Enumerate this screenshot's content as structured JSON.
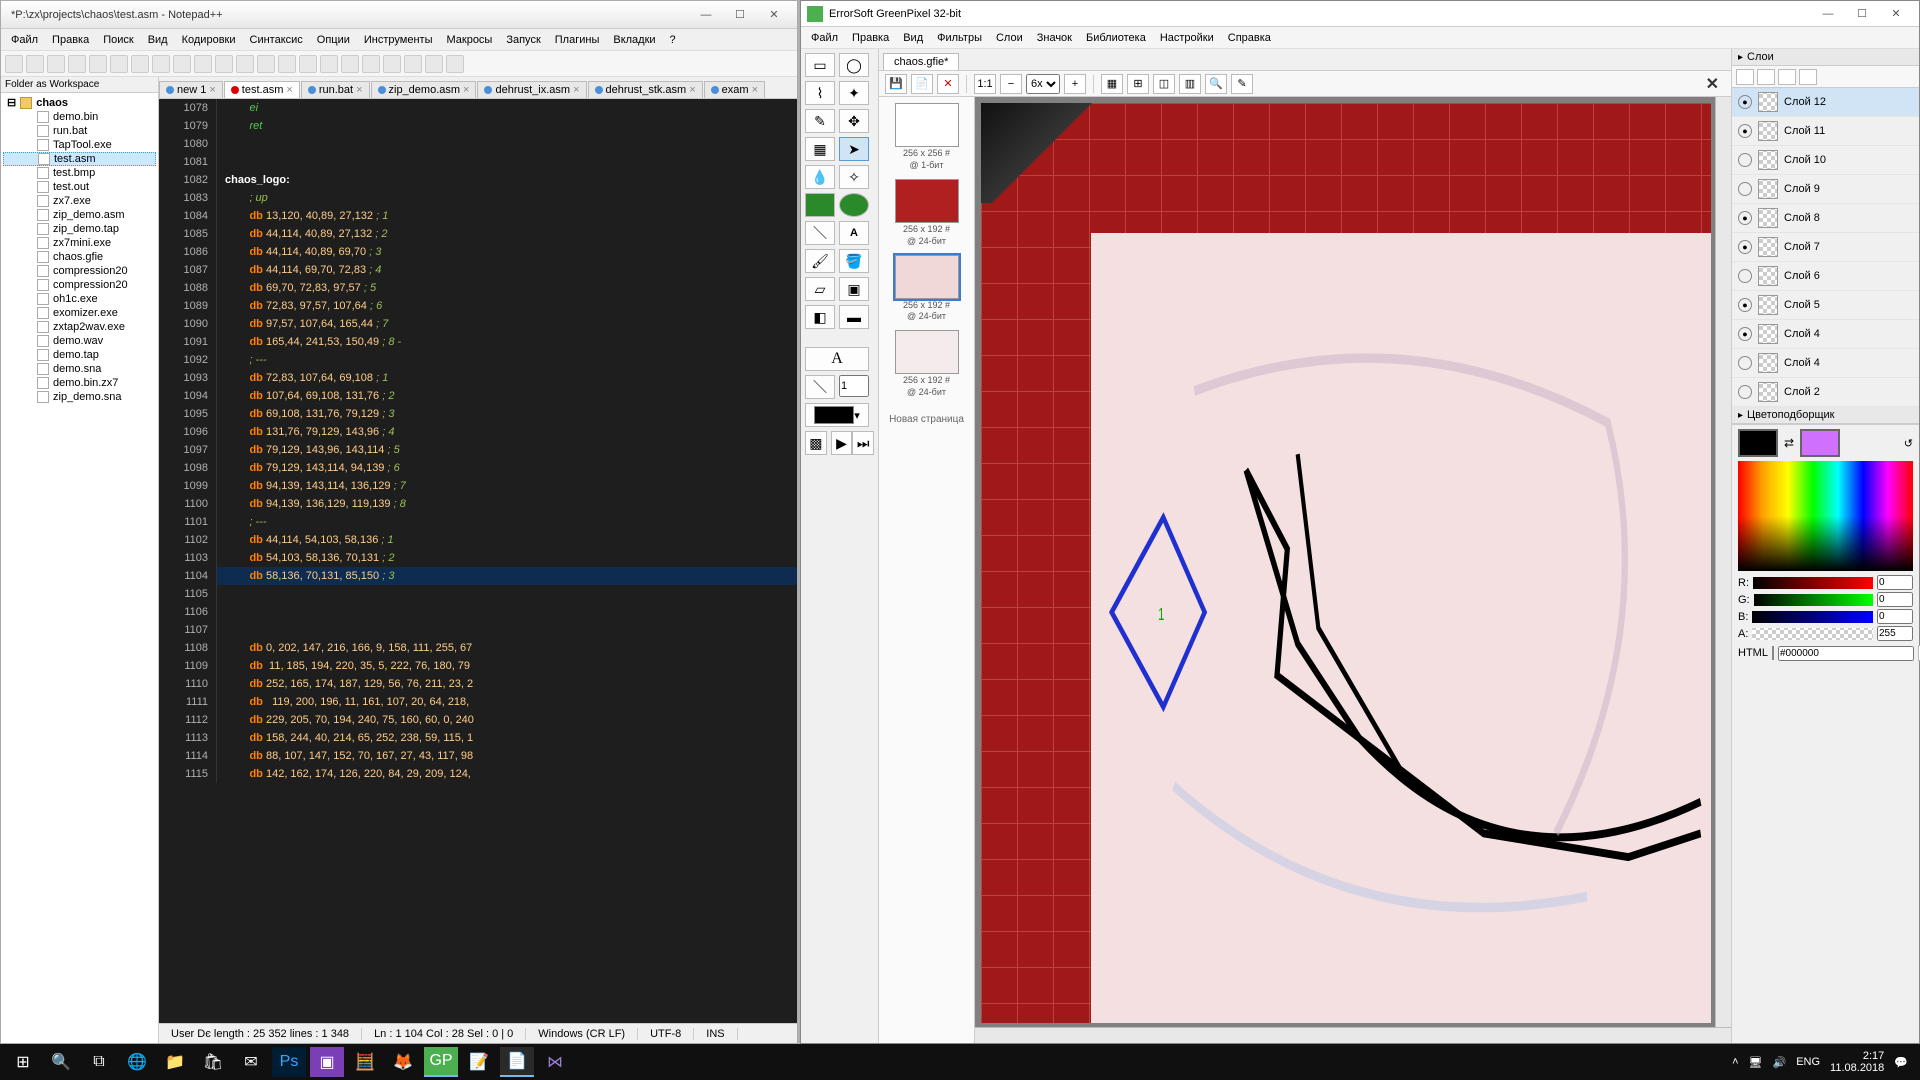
{
  "notepad": {
    "title": "*P:\\zx\\projects\\chaos\\test.asm - Notepad++",
    "menu": [
      "Файл",
      "Правка",
      "Поиск",
      "Вид",
      "Кодировки",
      "Синтаксис",
      "Опции",
      "Инструменты",
      "Макросы",
      "Запуск",
      "Плагины",
      "Вкладки",
      "?"
    ],
    "folder_title": "Folder as Workspace",
    "tree_root": "chaos",
    "tree": [
      "demo.bin",
      "run.bat",
      "TapTool.exe",
      "test.asm",
      "test.bmp",
      "test.out",
      "zx7.exe",
      "zip_demo.asm",
      "zip_demo.tap",
      "zx7mini.exe",
      "chaos.gfie",
      "compression20",
      "compression20",
      "oh1c.exe",
      "exomizer.exe",
      "zxtap2wav.exe",
      "demo.wav",
      "demo.tap",
      "demo.sna",
      "demo.bin.zx7",
      "zip_demo.sna"
    ],
    "tree_sel": "test.asm",
    "tabs": [
      {
        "label": "new 1",
        "mod": false
      },
      {
        "label": "test.asm",
        "mod": true,
        "active": true
      },
      {
        "label": "run.bat",
        "mod": false
      },
      {
        "label": "zip_demo.asm",
        "mod": false
      },
      {
        "label": "dehrust_ix.asm",
        "mod": false
      },
      {
        "label": "dehrust_stk.asm",
        "mod": false
      },
      {
        "label": "exam",
        "mod": false
      }
    ],
    "code": [
      {
        "n": "1078",
        "t": "        ei",
        "k": "green"
      },
      {
        "n": "1079",
        "t": "        ret",
        "k": "green"
      },
      {
        "n": "1080",
        "t": ""
      },
      {
        "n": "1081",
        "t": ""
      },
      {
        "n": "1082",
        "t": "chaos_logo:",
        "k": "label"
      },
      {
        "n": "1083",
        "t": "        ; up",
        "k": "cmt"
      },
      {
        "n": "1084",
        "db": "db",
        "args": "13,120, 40,89, 27,132",
        "c": "; 1"
      },
      {
        "n": "1085",
        "db": "db",
        "args": "44,114, 40,89, 27,132",
        "c": "; 2"
      },
      {
        "n": "1086",
        "db": "db",
        "args": "44,114, 40,89, 69,70",
        "c": "; 3"
      },
      {
        "n": "1087",
        "db": "db",
        "args": "44,114, 69,70, 72,83",
        "c": "; 4"
      },
      {
        "n": "1088",
        "db": "db",
        "args": "69,70, 72,83, 97,57",
        "c": "; 5"
      },
      {
        "n": "1089",
        "db": "db",
        "args": "72,83, 97,57, 107,64",
        "c": "; 6"
      },
      {
        "n": "1090",
        "db": "db",
        "args": "97,57, 107,64, 165,44",
        "c": "; 7"
      },
      {
        "n": "1091",
        "db": "db",
        "args": "165,44, 241,53, 150,49",
        "c": "; 8 -"
      },
      {
        "n": "1092",
        "t": "        ; ---",
        "k": "cmt"
      },
      {
        "n": "1093",
        "db": "db",
        "args": "72,83, 107,64, 69,108",
        "c": "; 1"
      },
      {
        "n": "1094",
        "db": "db",
        "args": "107,64, 69,108, 131,76",
        "c": "; 2"
      },
      {
        "n": "1095",
        "db": "db",
        "args": "69,108, 131,76, 79,129",
        "c": "; 3"
      },
      {
        "n": "1096",
        "db": "db",
        "args": "131,76, 79,129, 143,96",
        "c": "; 4"
      },
      {
        "n": "1097",
        "db": "db",
        "args": "79,129, 143,96, 143,114",
        "c": "; 5"
      },
      {
        "n": "1098",
        "db": "db",
        "args": "79,129, 143,114, 94,139",
        "c": "; 6"
      },
      {
        "n": "1099",
        "db": "db",
        "args": "94,139, 143,114, 136,129",
        "c": "; 7"
      },
      {
        "n": "1100",
        "db": "db",
        "args": "94,139, 136,129, 119,139",
        "c": "; 8"
      },
      {
        "n": "1101",
        "t": "        ; ---",
        "k": "cmt"
      },
      {
        "n": "1102",
        "db": "db",
        "args": "44,114, 54,103, 58,136",
        "c": "; 1"
      },
      {
        "n": "1103",
        "db": "db",
        "args": "54,103, 58,136, 70,131",
        "c": "; 2"
      },
      {
        "n": "1104",
        "db": "db",
        "args": "58,136, 70,131, 85,150",
        "c": "; 3",
        "hl": true
      },
      {
        "n": "1105",
        "t": ""
      },
      {
        "n": "1106",
        "t": ""
      },
      {
        "n": "1107",
        "t": ""
      },
      {
        "n": "1108",
        "db": "db",
        "args": "0, 202, 147, 216, 166, 9, 158, 111, 255, 67"
      },
      {
        "n": "1109",
        "db": "db",
        "args": " 11, 185, 194, 220, 35, 5, 222, 76, 180, 79"
      },
      {
        "n": "1110",
        "db": "db",
        "args": "252, 165, 174, 187, 129, 56, 76, 211, 23, 2"
      },
      {
        "n": "1111",
        "db": "db",
        "args": "  119, 200, 196, 11, 161, 107, 20, 64, 218,"
      },
      {
        "n": "1112",
        "db": "db",
        "args": "229, 205, 70, 194, 240, 75, 160, 60, 0, 240"
      },
      {
        "n": "1113",
        "db": "db",
        "args": "158, 244, 40, 214, 65, 252, 238, 59, 115, 1"
      },
      {
        "n": "1114",
        "db": "db",
        "args": "88, 107, 147, 152, 70, 167, 27, 43, 117, 98"
      },
      {
        "n": "1115",
        "db": "db",
        "args": "142, 162, 174, 126, 220, 84, 29, 209, 124,"
      }
    ],
    "status": {
      "len": "User Dє length : 25 352    lines : 1 348",
      "pos": "Ln : 1 104   Col : 28   Sel : 0 | 0",
      "eol": "Windows (CR LF)",
      "enc": "UTF-8",
      "ins": "INS"
    }
  },
  "greenpixel": {
    "title": "ErrorSoft GreenPixel 32-bit",
    "menu": [
      "Файл",
      "Правка",
      "Вид",
      "Фильтры",
      "Слои",
      "Значок",
      "Библиотека",
      "Настройки",
      "Справка"
    ],
    "doc_tab": "chaos.gfie*",
    "zoom": "6x",
    "frames": [
      {
        "cap1": "256 x 256 #",
        "cap2": "@ 1-бит",
        "bg": "#fff"
      },
      {
        "cap1": "256 x 192 #",
        "cap2": "@ 24-бит",
        "bg": "#b02020"
      },
      {
        "cap1": "256 x 192 #",
        "cap2": "@ 24-бит",
        "bg": "#f0d8d8",
        "sel": true
      },
      {
        "cap1": "256 x 192 #",
        "cap2": "@ 24-бит",
        "bg": "#f4ecec"
      }
    ],
    "newpage": "Новая страница",
    "layers_title": "Слои",
    "layers": [
      {
        "name": "Слой 12",
        "vis": true,
        "sel": true
      },
      {
        "name": "Слой 11",
        "vis": true
      },
      {
        "name": "Слой 10",
        "vis": false
      },
      {
        "name": "Слой 9",
        "vis": false
      },
      {
        "name": "Слой 8",
        "vis": true
      },
      {
        "name": "Слой 7",
        "vis": true
      },
      {
        "name": "Слой 6",
        "vis": false
      },
      {
        "name": "Слой 5",
        "vis": true
      },
      {
        "name": "Слой 4",
        "vis": true
      },
      {
        "name": "Слой 4",
        "vis": false
      },
      {
        "name": "Слой 2",
        "vis": false
      }
    ],
    "colorpicker_title": "Цветоподборщик",
    "rgb": {
      "r": "0",
      "g": "0",
      "b": "0",
      "a": "255"
    },
    "html_label": "HTML",
    "html_value": "#000000",
    "sys": "sys"
  },
  "taskbar": {
    "time": "2:17",
    "date": "11.08.2018",
    "lang": "ENG"
  }
}
